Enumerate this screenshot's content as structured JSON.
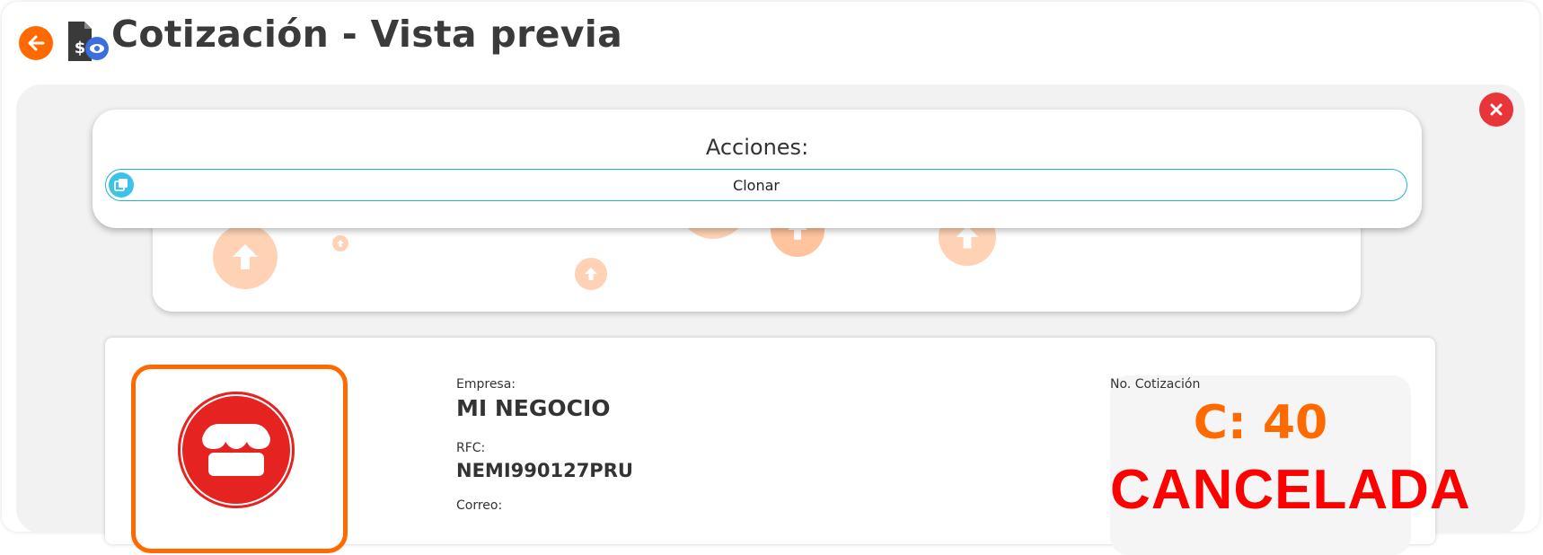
{
  "header": {
    "title": "Cotización - Vista previa"
  },
  "actions": {
    "title": "Acciones:",
    "clone_label": "Clonar"
  },
  "company": {
    "company_label": "Empresa:",
    "company_name": "MI NEGOCIO",
    "rfc_label": "RFC:",
    "rfc_value": "NEMI990127PRU",
    "email_label": "Correo:"
  },
  "quote": {
    "number_label": "No. Cotización",
    "number": "C: 40",
    "status": "CANCELADA"
  },
  "colors": {
    "accent": "#ff6a00",
    "danger": "#e8353a",
    "status": "#ff0000",
    "clone_border": "#22b5d8"
  },
  "icons": {
    "back": "arrow-left-icon",
    "title": "invoice-preview-icon",
    "close": "close-icon",
    "clone": "copy-icon",
    "logo": "store-icon",
    "upload": "upload-arrow-icon"
  }
}
